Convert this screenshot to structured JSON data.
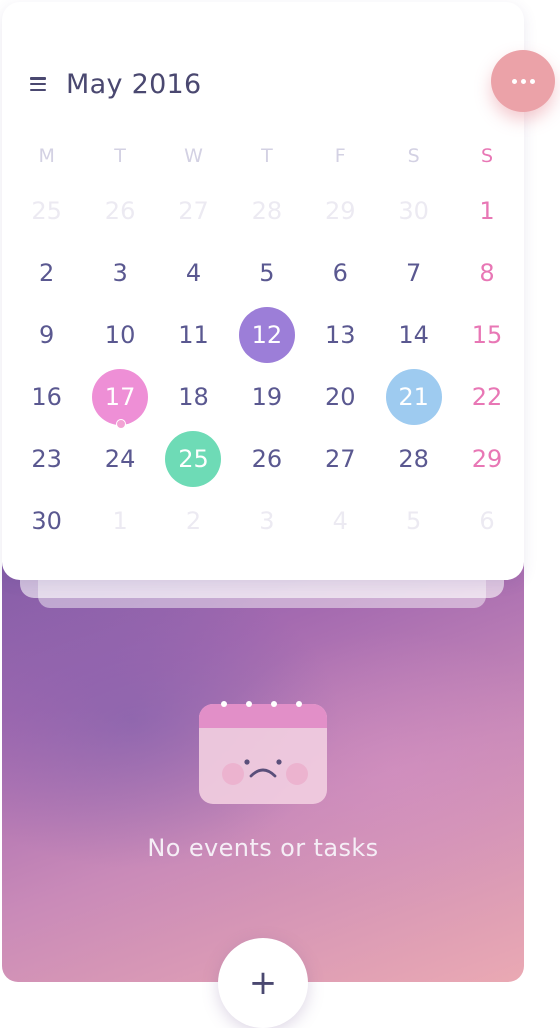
{
  "header": {
    "month_label": "May 2016",
    "menu_icon": "hamburger-menu-icon",
    "more_icon": "more-dots-icon",
    "more_color": "#eba2a8"
  },
  "weekdays": [
    "M",
    "T",
    "W",
    "T",
    "F",
    "S",
    "S"
  ],
  "weeks": [
    [
      {
        "label": "25",
        "muted": true
      },
      {
        "label": "26",
        "muted": true
      },
      {
        "label": "27",
        "muted": true
      },
      {
        "label": "28",
        "muted": true
      },
      {
        "label": "29",
        "muted": true
      },
      {
        "label": "30",
        "muted": true
      },
      {
        "label": "1",
        "muted": false
      }
    ],
    [
      {
        "label": "2"
      },
      {
        "label": "3"
      },
      {
        "label": "4"
      },
      {
        "label": "5"
      },
      {
        "label": "6"
      },
      {
        "label": "7"
      },
      {
        "label": "8"
      }
    ],
    [
      {
        "label": "9"
      },
      {
        "label": "10"
      },
      {
        "label": "11"
      },
      {
        "label": "12",
        "highlight": "#9c7ed8",
        "status": "selected"
      },
      {
        "label": "13"
      },
      {
        "label": "14"
      },
      {
        "label": "15"
      }
    ],
    [
      {
        "label": "16"
      },
      {
        "label": "17",
        "highlight": "#ee8fd6",
        "status": "today",
        "has_event": true
      },
      {
        "label": "18"
      },
      {
        "label": "19"
      },
      {
        "label": "20"
      },
      {
        "label": "21",
        "highlight": "#9ecbf0",
        "status": "marked"
      },
      {
        "label": "22"
      }
    ],
    [
      {
        "label": "23"
      },
      {
        "label": "24"
      },
      {
        "label": "25",
        "highlight": "#6edbb6",
        "status": "marked"
      },
      {
        "label": "26"
      },
      {
        "label": "27"
      },
      {
        "label": "28"
      },
      {
        "label": "29"
      }
    ],
    [
      {
        "label": "30"
      },
      {
        "label": "1",
        "muted": true
      },
      {
        "label": "2",
        "muted": true
      },
      {
        "label": "3",
        "muted": true
      },
      {
        "label": "4",
        "muted": true
      },
      {
        "label": "5",
        "muted": true
      },
      {
        "label": "6",
        "muted": true
      }
    ]
  ],
  "colors": {
    "weekday_text": "#5a5890",
    "sunday_text": "#e877b5",
    "muted_text": "#eceaf2"
  },
  "empty_state": {
    "icon": "sad-calendar-icon",
    "message": "No events or tasks"
  },
  "add_button": {
    "label": "+",
    "icon": "plus-icon"
  }
}
